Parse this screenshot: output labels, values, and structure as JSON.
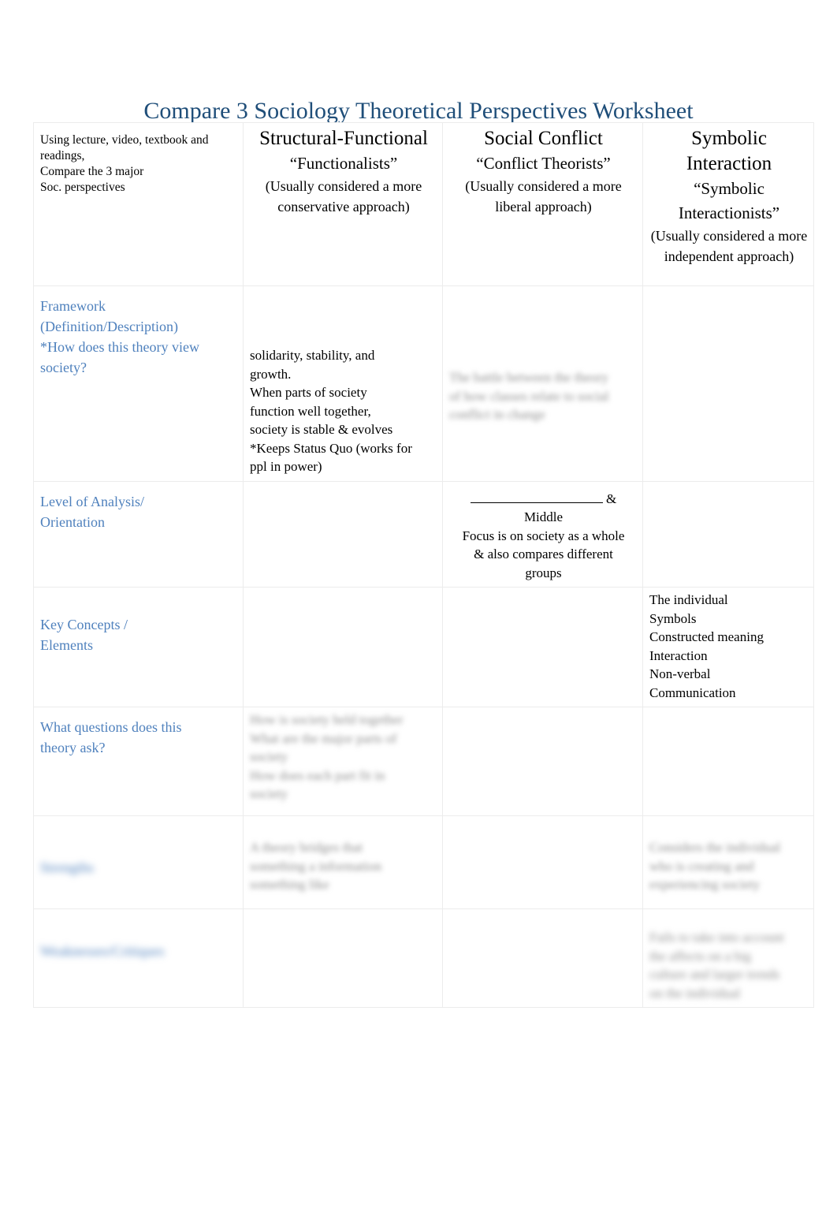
{
  "document": {
    "title": "Compare 3 Sociology Theoretical Perspectives Worksheet"
  },
  "table": {
    "header": {
      "instructions": [
        "Using lecture, video, textbook and readings,",
        "Compare the 3 major",
        "Soc. perspectives"
      ],
      "columns": [
        {
          "name": "Structural-Functional",
          "alias": "“Functionalists”",
          "note": "(Usually considered a more conservative approach)"
        },
        {
          "name": "Social Conflict",
          "alias": "“Conflict Theorists”",
          "note": "(Usually considered a more liberal approach)"
        },
        {
          "name": "Symbolic Interaction",
          "alias": "“Symbolic Interactionists”",
          "note": "(Usually considered a more independent approach)"
        }
      ]
    },
    "rows": [
      {
        "label_lines": [
          "Framework",
          "(Definition/Description)",
          "*How does this theory view",
          "society?"
        ],
        "label_redacted": false,
        "structural_functional": [
          "solidarity, stability, and",
          "growth.",
          "When parts of society",
          "function well together,",
          "society is stable & evolves",
          "*Keeps Status Quo (works for",
          "ppl in power)"
        ],
        "social_conflict": [
          "The battle between the theory",
          "of how classes relate to social",
          "conflict in change"
        ],
        "social_conflict_redacted": true,
        "symbolic_interaction": []
      },
      {
        "label_lines": [
          "Level of Analysis/",
          "Orientation"
        ],
        "label_redacted": false,
        "structural_functional": [],
        "social_conflict_prefix_blank": true,
        "social_conflict": [
          "&",
          "Middle",
          "Focus is on society as a whole",
          "& also compares different",
          "groups"
        ],
        "symbolic_interaction": []
      },
      {
        "label_lines": [
          "Key Concepts /",
          "Elements"
        ],
        "label_redacted": false,
        "structural_functional": [],
        "social_conflict": [],
        "symbolic_interaction": [
          "The individual",
          "Symbols",
          "Constructed meaning",
          "Interaction",
          "Non-verbal",
          "Communication"
        ]
      },
      {
        "label_lines": [
          "What questions does this",
          "theory ask?"
        ],
        "label_redacted": false,
        "structural_functional": [
          "How is society held together",
          "What are the major parts of",
          "society",
          "How does each part fit in",
          "society"
        ],
        "structural_functional_redacted": true,
        "social_conflict": [],
        "symbolic_interaction": []
      },
      {
        "label_lines": [
          "Strengths"
        ],
        "label_redacted": true,
        "structural_functional": [
          "A theory bridges that",
          "something a information",
          "something like"
        ],
        "structural_functional_redacted": true,
        "social_conflict": [],
        "symbolic_interaction": [
          "Considers the individual",
          "who is creating and",
          "experiencing society"
        ],
        "symbolic_interaction_redacted": true
      },
      {
        "label_lines": [
          "Weaknesses/Critiques"
        ],
        "label_redacted": true,
        "structural_functional": [],
        "social_conflict": [],
        "symbolic_interaction": [
          "Fails to take into account",
          "the affects on a big",
          "culture and larger trends",
          "on the individual"
        ],
        "symbolic_interaction_redacted": true
      }
    ]
  }
}
